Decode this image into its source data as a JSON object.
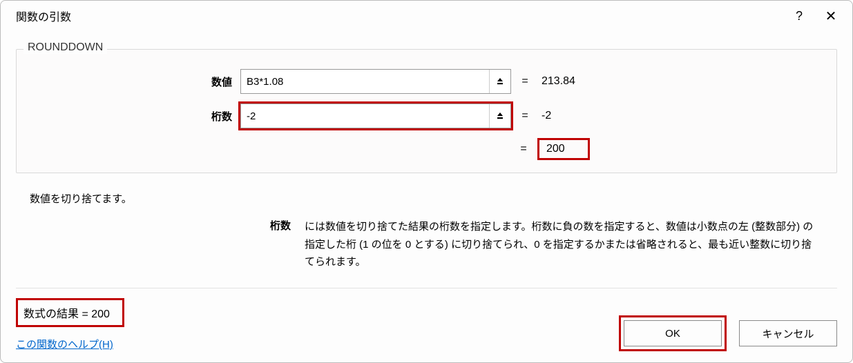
{
  "titlebar": {
    "title": "関数の引数"
  },
  "group": {
    "legend": "ROUNDDOWN"
  },
  "args": {
    "number": {
      "label": "数値",
      "value": "B3*1.08",
      "result": "213.84"
    },
    "digits": {
      "label": "桁数",
      "value": "-2",
      "result": "-2"
    }
  },
  "computed": {
    "equals": "=",
    "value": "200"
  },
  "description": {
    "summary": "数値を切り捨てます。",
    "arg_label": "桁数",
    "arg_text": "には数値を切り捨てた結果の桁数を指定します。桁数に負の数を指定すると、数値は小数点の左 (整数部分) の指定した桁 (1 の位を 0 とする) に切り捨てられ、0 を指定するかまたは省略されると、最も近い整数に切り捨てられます。"
  },
  "footer": {
    "formula_label": "数式の結果 = ",
    "formula_value": "200",
    "help_link": "この関数のヘルプ(H)",
    "ok": "OK",
    "cancel": "キャンセル"
  }
}
